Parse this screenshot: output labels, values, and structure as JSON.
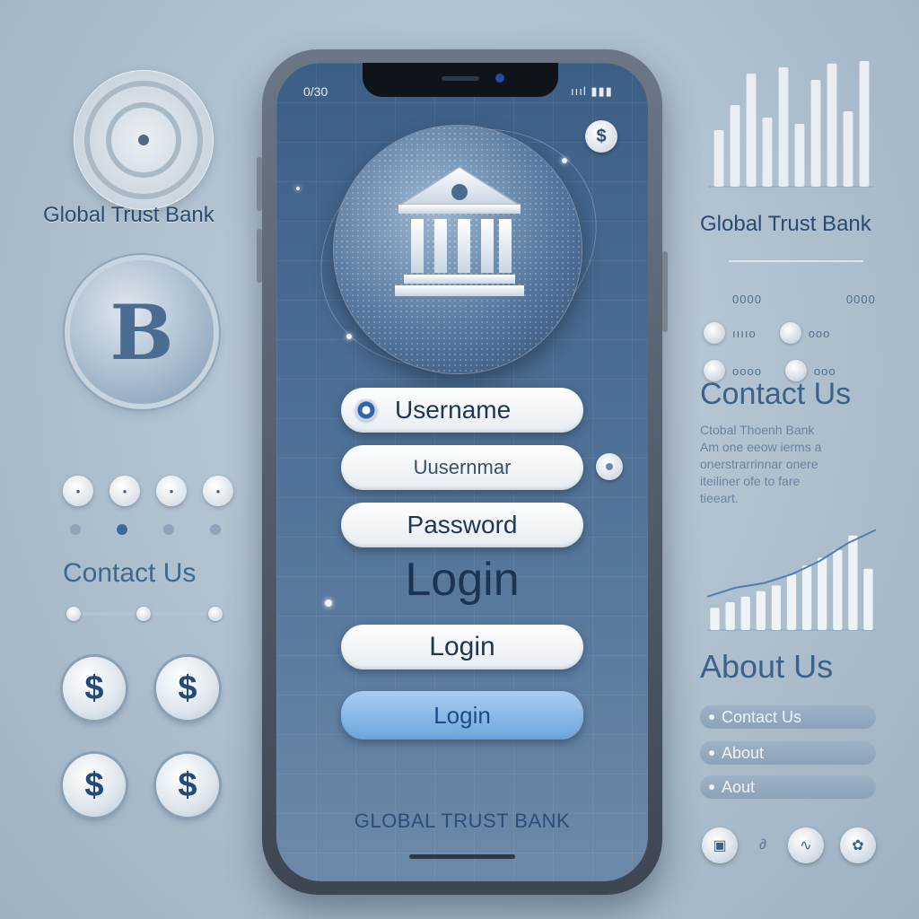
{
  "left_panel": {
    "brand": "Global Trust Bank",
    "coin_symbol": "B",
    "contact": "Contact Us",
    "dollar_symbol": "$"
  },
  "phone": {
    "status_time": "0/30",
    "status_icons": "ıııl ▮▮▮",
    "small_badge": "$",
    "username_primary": "Username",
    "username_secondary": "Uusernmar",
    "password": "Password",
    "login_heading": "Login",
    "login_button": "Login",
    "login_primary_button": "Login",
    "brand_footer": "GLOBAL TRUST BANK"
  },
  "right_panel": {
    "brand": "Global Trust Bank",
    "contact": "Contact Us",
    "blurb_lines": [
      "Ctobal Thoenh Bank",
      "Am one eeow ierms a",
      "onerstrarrinnar onere",
      "iteiliner ofe to fare",
      "tieeart."
    ],
    "icon_row_labels": [
      [
        "0000",
        "0000"
      ],
      [
        "ııııo",
        "ooo"
      ],
      [
        "oooo",
        "ooo"
      ]
    ],
    "about": "About Us",
    "pills": [
      "Contact Us",
      "About",
      "Aout"
    ]
  },
  "chart_top": {
    "values": [
      0.45,
      0.65,
      0.9,
      0.55,
      0.95,
      0.5,
      0.85,
      0.98,
      0.6,
      1.0
    ]
  },
  "chart_bottom": {
    "values": [
      0.2,
      0.25,
      0.3,
      0.35,
      0.4,
      0.5,
      0.58,
      0.65,
      0.72,
      0.85,
      0.55
    ],
    "trend": [
      0.3,
      0.38,
      0.42,
      0.5,
      0.62,
      0.78,
      0.9
    ]
  },
  "colors": {
    "accent": "#6ea6dc",
    "brand_text": "#2a4a70",
    "screen_top": "#3d5f86"
  }
}
